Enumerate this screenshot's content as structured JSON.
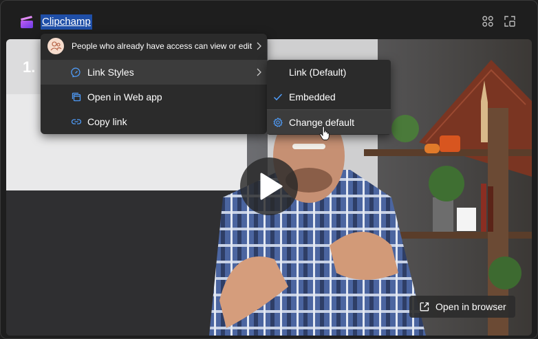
{
  "header": {
    "title": "Clipchamp",
    "app_icon": "clipchamp-icon",
    "grid_icon": "app-grid-icon",
    "expand_icon": "expand-icon"
  },
  "video": {
    "title_fragment": "1. I",
    "play_icon": "play-icon",
    "open_in_browser": "Open in browser"
  },
  "menu": {
    "access_text": "People who already have access can view or edit",
    "items": [
      {
        "label": "Link Styles",
        "icon": "link-styles-icon",
        "has_submenu": true
      },
      {
        "label": "Open in Web app",
        "icon": "web-app-icon",
        "has_submenu": false
      },
      {
        "label": "Copy link",
        "icon": "link-icon",
        "has_submenu": false
      }
    ]
  },
  "submenu": {
    "items": [
      {
        "label": "Link (Default)",
        "checked": false
      },
      {
        "label": "Embedded",
        "checked": true
      },
      {
        "label": "Change default",
        "icon": "gear-icon"
      }
    ]
  },
  "colors": {
    "accent": "#4f9cf9",
    "title_highlight": "#1f4fa8",
    "menu_bg": "#2b2b2b",
    "menu_hover": "#3c3c3c"
  }
}
